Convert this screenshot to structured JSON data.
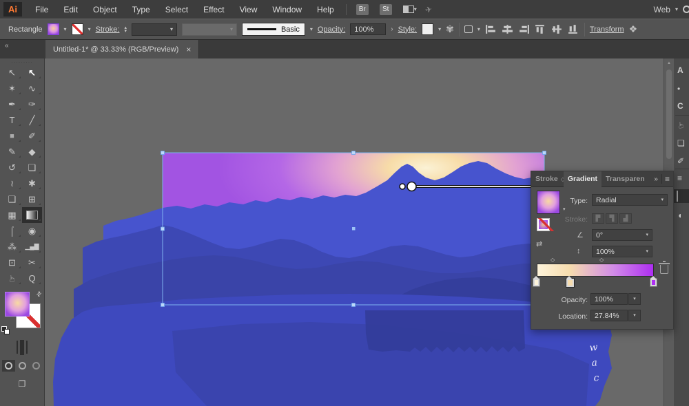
{
  "menubar": {
    "logo": "Ai",
    "items": [
      "File",
      "Edit",
      "Object",
      "Type",
      "Select",
      "Effect",
      "View",
      "Window",
      "Help"
    ],
    "bridge_button": "Br",
    "stock_button": "St",
    "workspace_label": "Web"
  },
  "controlbar": {
    "selection_type": "Rectangle",
    "stroke_label": "Stroke:",
    "brush_name": "Basic",
    "opacity_label": "Opacity:",
    "opacity_value": "100%",
    "style_label": "Style:",
    "transform_label": "Transform",
    "recolor_glyph": "✾",
    "isolate_glyph": "❖"
  },
  "tabbar": {
    "title": "Untitled-1* @ 33.33% (RGB/Preview)",
    "close_glyph": "×"
  },
  "toolbar": {
    "collapse_glyph": "«",
    "drag_dots": ".........",
    "swap_glyph": "⇄",
    "screen_mode_glyph": "❐",
    "tools": [
      {
        "name": "selection-tool",
        "glyph": "↖"
      },
      {
        "name": "direct-selection-tool",
        "glyph": "↖"
      },
      {
        "name": "magic-wand-tool",
        "glyph": "✶"
      },
      {
        "name": "lasso-tool",
        "glyph": "∿"
      },
      {
        "name": "pen-tool",
        "glyph": "✒"
      },
      {
        "name": "curvature-tool",
        "glyph": "✑"
      },
      {
        "name": "type-tool",
        "glyph": "T"
      },
      {
        "name": "line-segment-tool",
        "glyph": "╱"
      },
      {
        "name": "rectangle-tool",
        "glyph": "■"
      },
      {
        "name": "paintbrush-tool",
        "glyph": "✐"
      },
      {
        "name": "pencil-tool",
        "glyph": "✎"
      },
      {
        "name": "eraser-tool",
        "glyph": "◆"
      },
      {
        "name": "rotate-tool",
        "glyph": "↺"
      },
      {
        "name": "scale-tool",
        "glyph": "❏"
      },
      {
        "name": "width-tool",
        "glyph": "≀"
      },
      {
        "name": "puppet-warp-tool",
        "glyph": "✱"
      },
      {
        "name": "shape-builder-tool",
        "glyph": "❑"
      },
      {
        "name": "perspective-grid-tool",
        "glyph": "⊞"
      },
      {
        "name": "mesh-tool",
        "glyph": "▦"
      },
      {
        "name": "gradient-tool",
        "glyph": ""
      },
      {
        "name": "eyedropper-tool",
        "glyph": "⌠"
      },
      {
        "name": "blend-tool",
        "glyph": "◉"
      },
      {
        "name": "symbol-sprayer-tool",
        "glyph": "⁂"
      },
      {
        "name": "column-graph-tool",
        "glyph": "▁▄▇"
      },
      {
        "name": "artboard-tool",
        "glyph": "⊡"
      },
      {
        "name": "slice-tool",
        "glyph": "✂"
      },
      {
        "name": "hand-tool",
        "glyph": "☞"
      },
      {
        "name": "zoom-tool",
        "glyph": "Q"
      }
    ]
  },
  "canvas": {
    "scroll_up_glyph": "▲",
    "script_letters": [
      "w",
      "a",
      "c"
    ]
  },
  "dock": {
    "icons": [
      {
        "name": "dock-color-icon",
        "glyph": "A"
      },
      {
        "name": "dock-dot-icon",
        "glyph": "•"
      },
      {
        "name": "dock-libraries-icon",
        "glyph": "C"
      },
      {
        "name": "dock-hand-icon",
        "glyph": "☞"
      },
      {
        "name": "dock-export-icon",
        "glyph": "❏"
      },
      {
        "name": "dock-brush-icon",
        "glyph": "✐"
      },
      {
        "name": "dock-stroke-icon",
        "glyph": "≡"
      },
      {
        "name": "dock-gradient-icon",
        "glyph": ""
      },
      {
        "name": "dock-transparency-icon",
        "glyph": "◖"
      }
    ]
  },
  "gradient_panel": {
    "tabs": {
      "stroke": "Stroke",
      "gradient": "Gradient",
      "transparency": "Transparen"
    },
    "tab_diamond_glyph": "◇",
    "overflow_glyph": "»",
    "menu_glyph": "≡",
    "type_label": "Type:",
    "type_value": "Radial",
    "stroke_label": "Stroke:",
    "angle_glyph": "∠",
    "angle_value": "0°",
    "aspect_glyph": "↕",
    "aspect_value": "100%",
    "reverse_glyph": "⇄",
    "opacity_label": "Opacity:",
    "opacity_value": "100%",
    "location_label": "Location:",
    "location_value": "27.84%",
    "stops": [
      {
        "color": "#FDF3DA",
        "location": "0%"
      },
      {
        "color": "#F6DCAE",
        "location": "27.84%"
      },
      {
        "color": "#AE2EF2",
        "location": "100%"
      }
    ]
  },
  "artwork_colors": {
    "sky_purple": "#A254E2",
    "sun_core": "#FBF2D5",
    "sun_mid": "#F6D9A6",
    "ridge_blue": "#4754CE",
    "hill2_blue": "#3D48B4",
    "hill3_blue": "#3A44A8",
    "dark_blue": "#343E9C",
    "blob_blue": "#3E49BE",
    "blob_shade": "#3A44AE",
    "forest_blue": "#333D9A",
    "selection_blue": "#7FB2F0"
  }
}
